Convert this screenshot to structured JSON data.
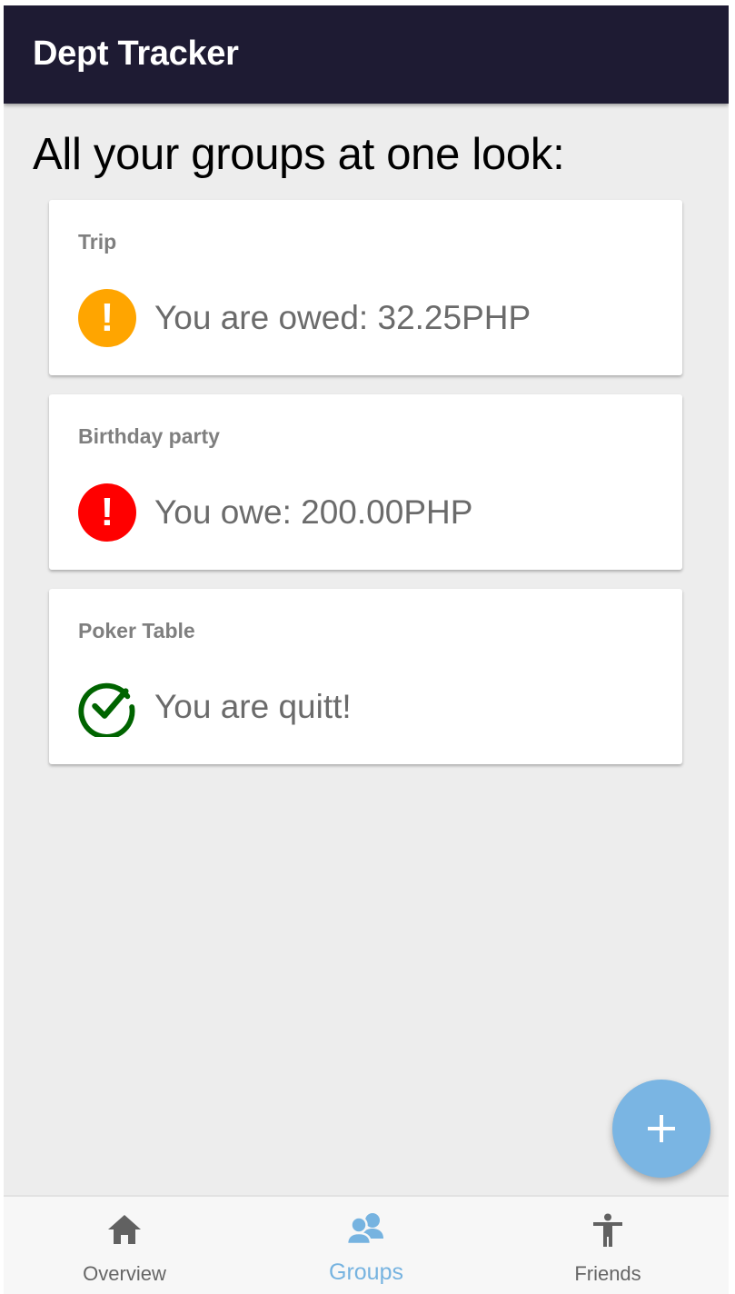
{
  "app": {
    "title": "Dept Tracker"
  },
  "page": {
    "heading": "All your groups at one look:"
  },
  "groups": [
    {
      "name": "Trip",
      "status_text": "You are owed: 32.25PHP",
      "status_icon": "exclamation-icon",
      "status_color": "#ffa500"
    },
    {
      "name": "Birthday party",
      "status_text": "You owe: 200.00PHP",
      "status_icon": "exclamation-icon",
      "status_color": "#ff0000"
    },
    {
      "name": "Poker Table",
      "status_text": "You are quitt!",
      "status_icon": "check-circle-icon",
      "status_color": "#006400"
    }
  ],
  "fab": {
    "icon": "plus-icon",
    "color": "#7ab5e3"
  },
  "bottom_nav": {
    "active_color": "#76b3e0",
    "items": [
      {
        "label": "Overview",
        "icon": "home-icon",
        "active": false
      },
      {
        "label": "Groups",
        "icon": "groups-icon",
        "active": true
      },
      {
        "label": "Friends",
        "icon": "person-icon",
        "active": false
      }
    ]
  }
}
